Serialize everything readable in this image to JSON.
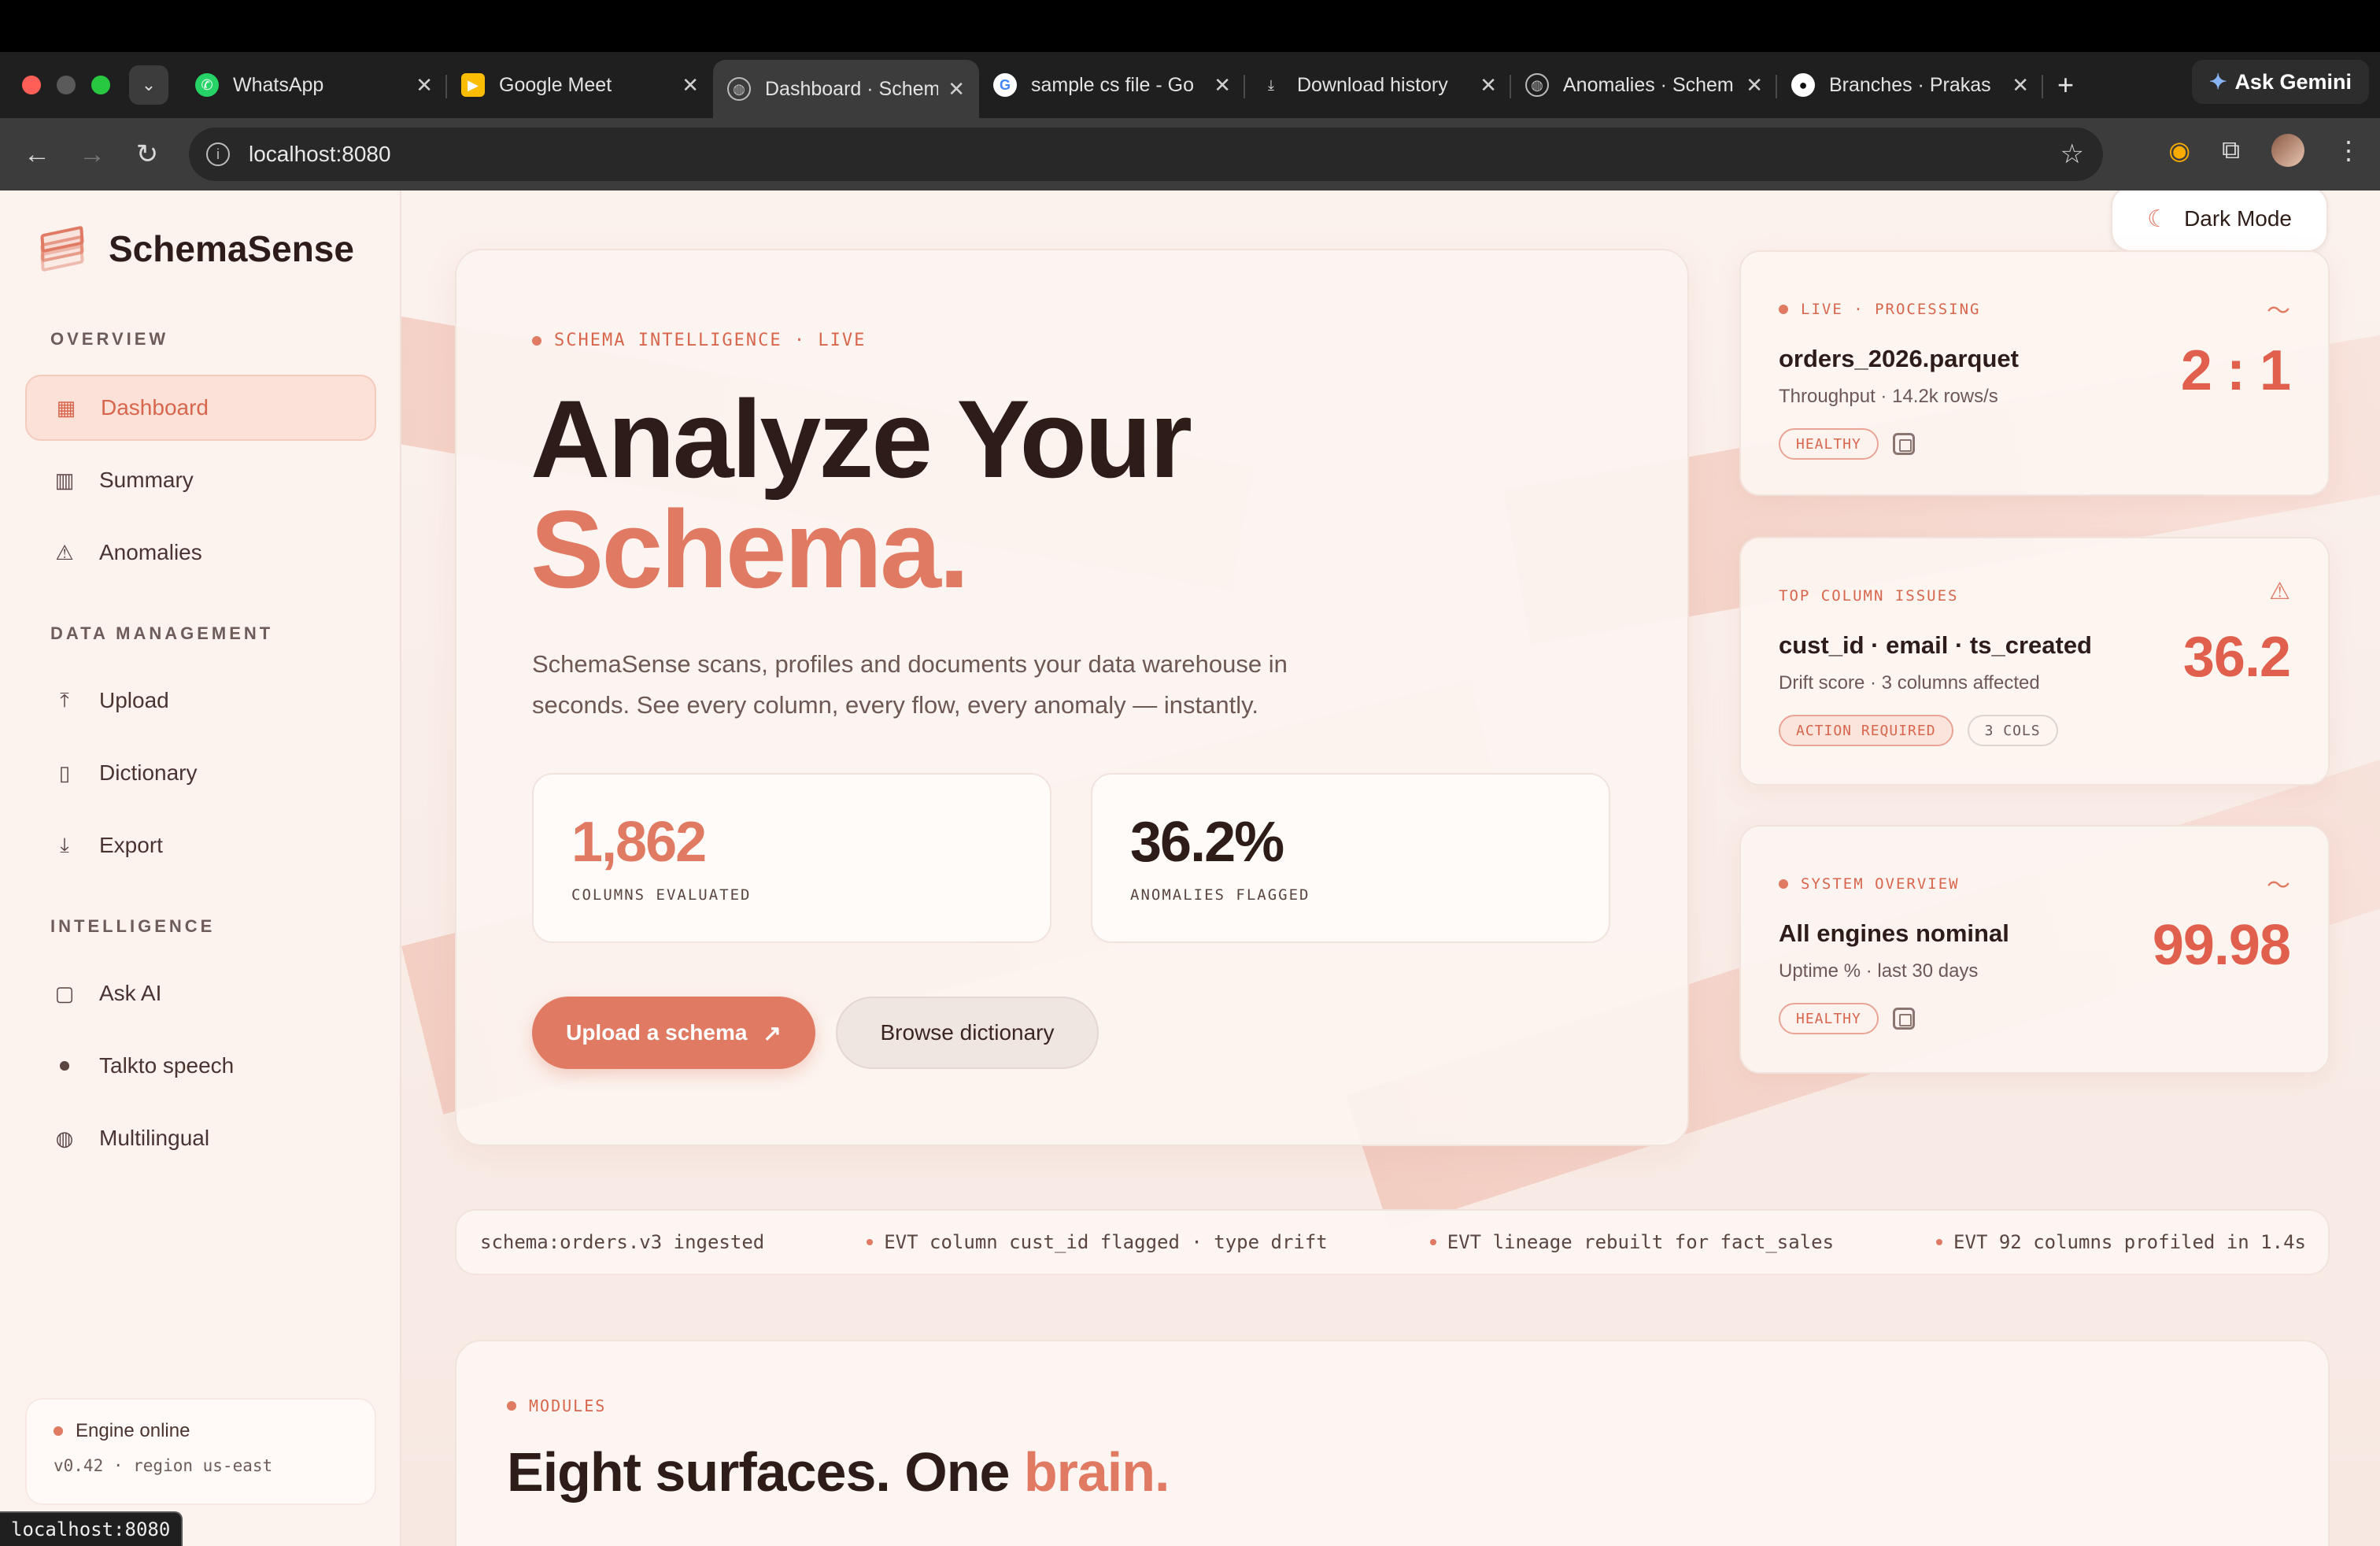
{
  "browser": {
    "tabs": [
      {
        "title": "WhatsApp",
        "icon": "whatsapp-icon"
      },
      {
        "title": "Google Meet",
        "icon": "google-meet-icon"
      },
      {
        "title": "Dashboard · Schem",
        "icon": "globe-icon",
        "active": true
      },
      {
        "title": "sample cs file - Go",
        "icon": "google-icon"
      },
      {
        "title": "Download history",
        "icon": "download-icon"
      },
      {
        "title": "Anomalies · Schem",
        "icon": "globe-icon"
      },
      {
        "title": "Branches · Prakas",
        "icon": "github-icon"
      }
    ],
    "gemini_label": "Ask Gemini",
    "url": "localhost:8080",
    "status_url": "localhost:8080"
  },
  "sidebar": {
    "brand": "SchemaSense",
    "sections": {
      "overview": "OVERVIEW",
      "data_management": "DATA MANAGEMENT",
      "intelligence": "INTELLIGENCE"
    },
    "items": [
      {
        "label": "Dashboard",
        "icon": "grid-icon",
        "active": true
      },
      {
        "label": "Summary",
        "icon": "bar-chart-icon"
      },
      {
        "label": "Anomalies",
        "icon": "warning-icon"
      },
      {
        "label": "Upload",
        "icon": "upload-icon"
      },
      {
        "label": "Dictionary",
        "icon": "book-icon"
      },
      {
        "label": "Export",
        "icon": "download-icon"
      },
      {
        "label": "Ask AI",
        "icon": "chat-icon"
      },
      {
        "label": "Talkto speech",
        "icon": "mic-icon"
      },
      {
        "label": "Multilingual",
        "icon": "globe-icon"
      }
    ],
    "engine": {
      "status": "Engine online",
      "detail": "v0.42 · region us-east"
    }
  },
  "header": {
    "dark_mode_label": "Dark Mode"
  },
  "hero": {
    "kicker": "SCHEMA INTELLIGENCE · LIVE",
    "title_line1": "Analyze Your",
    "title_line2": "Schema.",
    "lead": "SchemaSense scans, profiles and documents your data warehouse in seconds. See every column, every flow, every anomaly — instantly.",
    "stats": [
      {
        "value": "1,862",
        "label": "COLUMNS EVALUATED"
      },
      {
        "value": "36.2%",
        "label": "ANOMALIES FLAGGED"
      }
    ],
    "primary_button": "Upload a schema",
    "secondary_button": "Browse dictionary"
  },
  "cards": [
    {
      "kicker": "LIVE · PROCESSING",
      "title": "orders_2026.parquet",
      "subtitle": "Throughput · 14.2k rows/s",
      "value": "2 : 1",
      "badges": [
        "HEALTHY"
      ],
      "icon": "pulse-icon"
    },
    {
      "kicker": "TOP COLUMN ISSUES",
      "title": "cust_id · email · ts_created",
      "subtitle": "Drift score · 3 columns affected",
      "value": "36.2",
      "badges": [
        "ACTION REQUIRED",
        "3 COLS"
      ],
      "icon": "warning-icon"
    },
    {
      "kicker": "SYSTEM OVERVIEW",
      "title": "All engines nominal",
      "subtitle": "Uptime % · last 30 days",
      "value": "99.98",
      "badges": [
        "HEALTHY"
      ],
      "icon": "pulse-icon"
    }
  ],
  "ticker": [
    "schema:orders.v3 ingested",
    "EVT column cust_id flagged · type drift",
    "EVT lineage rebuilt for fact_sales",
    "EVT 92 columns profiled in 1.4s"
  ],
  "modules": {
    "kicker": "MODULES",
    "title_main": "Eight surfaces. One ",
    "title_accent": "brain."
  },
  "colors": {
    "accent": "#e07a63",
    "accent_dark": "#d8664d",
    "ink": "#2e1c18"
  }
}
